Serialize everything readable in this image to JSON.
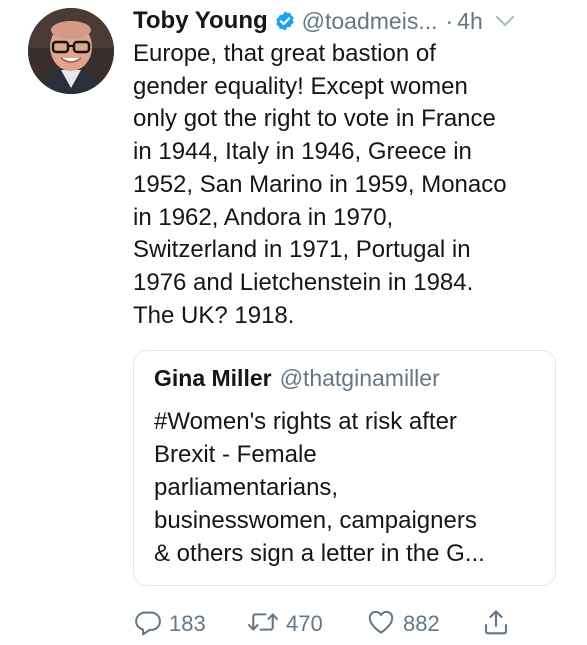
{
  "tweet": {
    "author": {
      "display_name": "Toby Young",
      "handle": "@toadmeis...",
      "verified_icon": "verified-badge-icon",
      "avatar": "avatar-photo"
    },
    "separator": "·",
    "timestamp": "4h",
    "menu_icon": "chevron-down-icon",
    "text_lines": [
      "Europe, that great bastion of",
      "gender equality! Except women",
      "only got the right to vote in France",
      "in 1944, Italy in 1946, Greece in",
      "1952, San Marino in 1959, Monaco",
      "in 1962, Andora in 1970,",
      "Switzerland in 1971, Portugal in",
      "1976 and Lietchenstein in 1984.",
      "The UK? 1918."
    ]
  },
  "quoted_tweet": {
    "display_name": "Gina Miller",
    "handle": "@thatginamiller",
    "text_lines": [
      "#Women's rights at risk after",
      "Brexit - Female",
      "parliamentarians,",
      "businesswomen, campaigners",
      "& others sign a letter in the G..."
    ]
  },
  "actions": {
    "reply": {
      "icon": "reply-icon",
      "count": "183"
    },
    "retweet": {
      "icon": "retweet-icon",
      "count": "470"
    },
    "like": {
      "icon": "heart-icon",
      "count": "882"
    },
    "share": {
      "icon": "share-icon"
    }
  },
  "colors": {
    "text_primary": "#14171a",
    "text_secondary": "#657786",
    "verified_blue": "#1da1f2",
    "border": "#e1e8ed"
  }
}
